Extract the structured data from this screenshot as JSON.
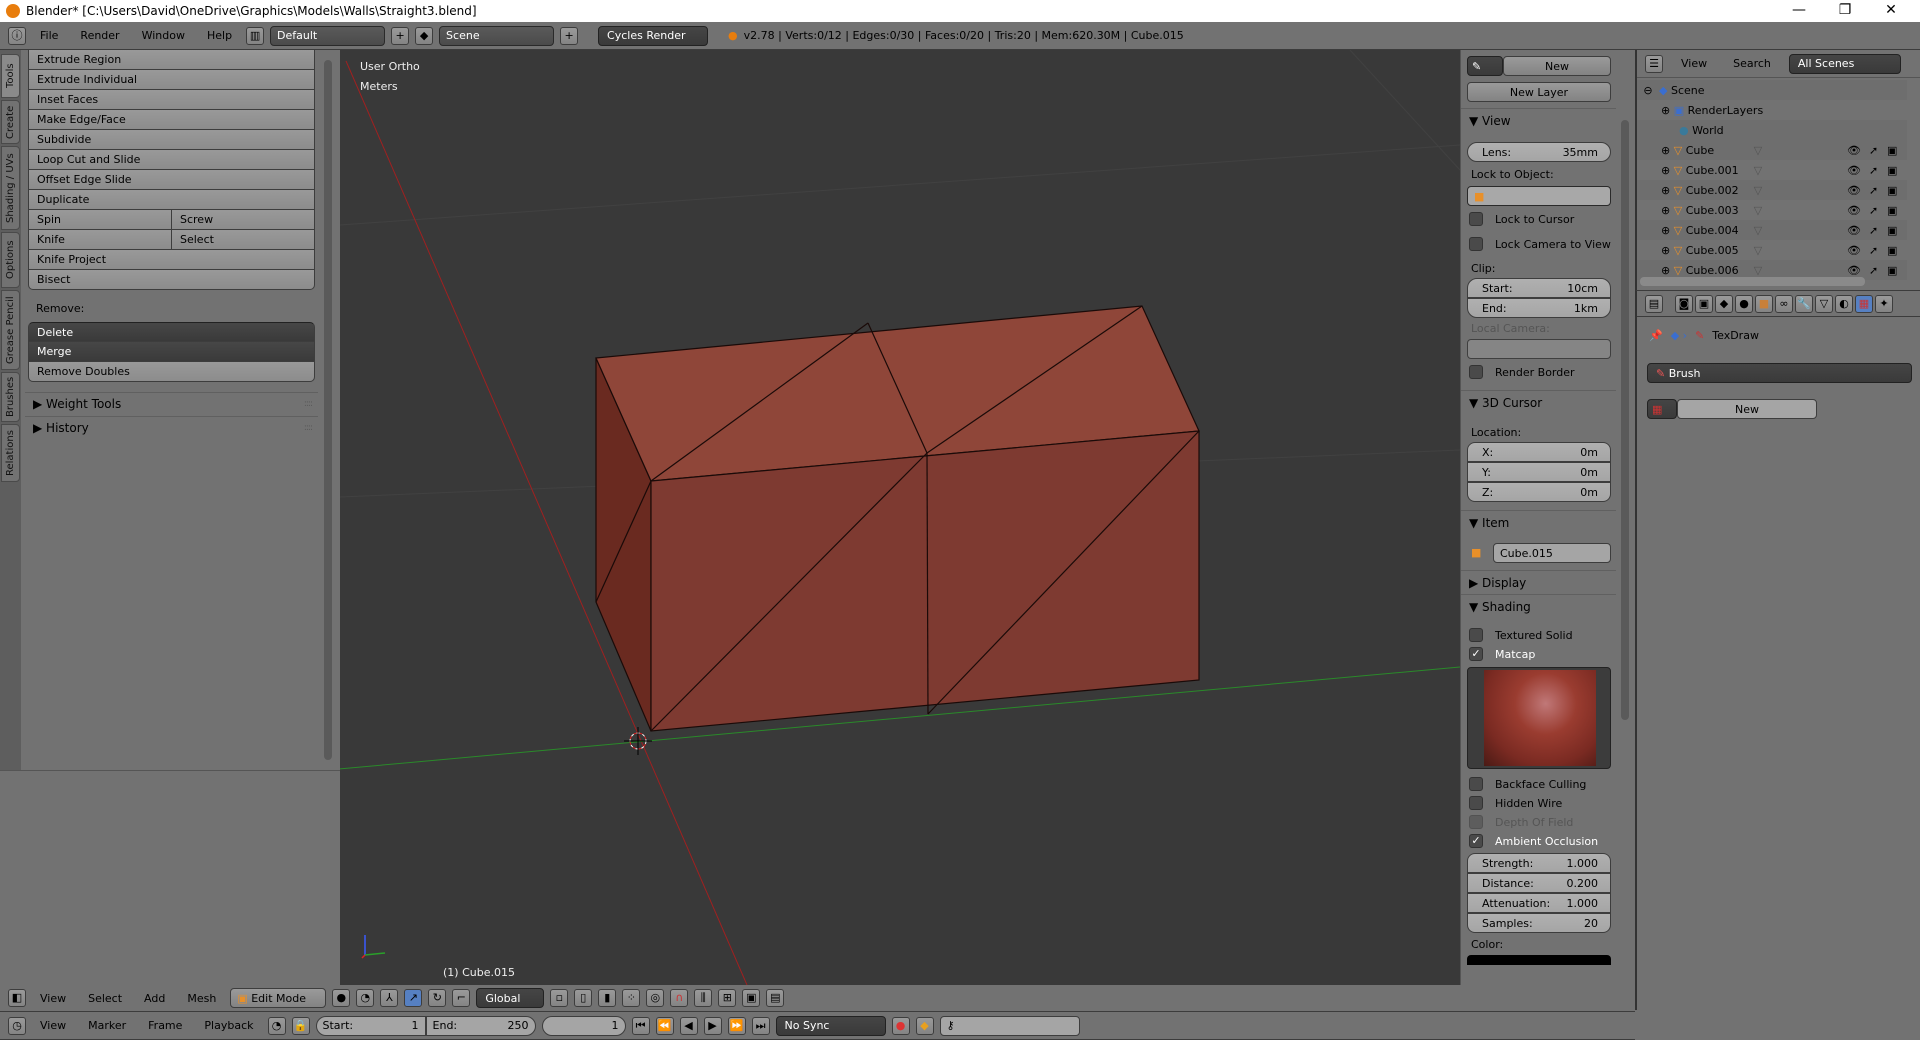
{
  "window": {
    "title": "Blender* [C:\\Users\\David\\OneDrive\\Graphics\\Models\\Walls\\Straight3.blend]",
    "minimize": "—",
    "maximize": "❐",
    "close": "✕"
  },
  "info_header": {
    "menus": [
      "File",
      "Render",
      "Window",
      "Help"
    ],
    "layout": "Default",
    "scene": "Scene",
    "engine": "Cycles Render",
    "stats": "v2.78 | Verts:0/12 | Edges:0/30 | Faces:0/20 | Tris:20 | Mem:620.30M | Cube.015"
  },
  "tool_tabs": [
    "Tools",
    "Create",
    "Shading / UVs",
    "Options",
    "Grease Pencil",
    "Brushes",
    "Relations"
  ],
  "tools": {
    "items": [
      "Extrude Region",
      "Extrude Individual",
      "Inset Faces",
      "Make Edge/Face",
      "Subdivide",
      "Loop Cut and Slide",
      "Offset Edge Slide",
      "Duplicate"
    ],
    "pairs": [
      [
        "Spin",
        "Screw"
      ],
      [
        "Knife",
        "Select"
      ]
    ],
    "items2": [
      "Knife Project",
      "Bisect"
    ],
    "remove_label": "Remove:",
    "delete": "Delete",
    "merge": "Merge",
    "remove_doubles": "Remove Doubles",
    "panels": [
      "Weight Tools",
      "History"
    ]
  },
  "viewport": {
    "view_name": "User Ortho",
    "units": "Meters",
    "object_label": "(1) Cube.015",
    "axis_x": "x",
    "axis_y": "y",
    "axis_z": "z"
  },
  "npanel": {
    "new": "New",
    "new_layer": "New Layer",
    "view_title": "View",
    "lens_label": "Lens:",
    "lens": "35mm",
    "lock_to_object": "Lock to Object:",
    "lock_to_cursor": "Lock to Cursor",
    "lock_camera": "Lock Camera to View",
    "clip": "Clip:",
    "start_label": "Start:",
    "start": "10cm",
    "end_label": "End:",
    "end": "1km",
    "local_camera": "Local Camera:",
    "render_border": "Render Border",
    "cursor_title": "3D Cursor",
    "location": "Location:",
    "x_label": "X:",
    "x": "0m",
    "y_label": "Y:",
    "y": "0m",
    "z_label": "Z:",
    "z": "0m",
    "item_title": "Item",
    "item_name": "Cube.015",
    "display_title": "Display",
    "shading_title": "Shading",
    "textured_solid": "Textured Solid",
    "matcap": "Matcap",
    "backface_culling": "Backface Culling",
    "hidden_wire": "Hidden Wire",
    "depth_of_field": "Depth Of Field",
    "ambient_occlusion": "Ambient Occlusion",
    "strength_label": "Strength:",
    "strength": "1.000",
    "distance_label": "Distance:",
    "distance": "0.200",
    "attenuation_label": "Attenuation:",
    "attenuation": "1.000",
    "samples_label": "Samples:",
    "samples": "20",
    "color_label": "Color:"
  },
  "outliner": {
    "view": "View",
    "search": "Search",
    "filter": "All Scenes",
    "scene": "Scene",
    "render_layers": "RenderLayers",
    "world": "World",
    "objects": [
      "Cube",
      "Cube.001",
      "Cube.002",
      "Cube.003",
      "Cube.004",
      "Cube.005",
      "Cube.006"
    ]
  },
  "properties": {
    "breadcrumb": "TexDraw",
    "brush": "Brush",
    "new": "New"
  },
  "header3d": {
    "menus": [
      "View",
      "Select",
      "Add",
      "Mesh"
    ],
    "mode": "Edit Mode",
    "orientation": "Global"
  },
  "timeline": {
    "menus": [
      "View",
      "Marker",
      "Frame",
      "Playback"
    ],
    "start_label": "Start:",
    "start": "1",
    "end_label": "End:",
    "end": "250",
    "current": "1",
    "sync": "No Sync"
  },
  "colors": {
    "mesh": "#8c4236",
    "viewport_bg": "#393939",
    "x_axis": "#a02020",
    "y_axis": "#2a8a2a"
  }
}
